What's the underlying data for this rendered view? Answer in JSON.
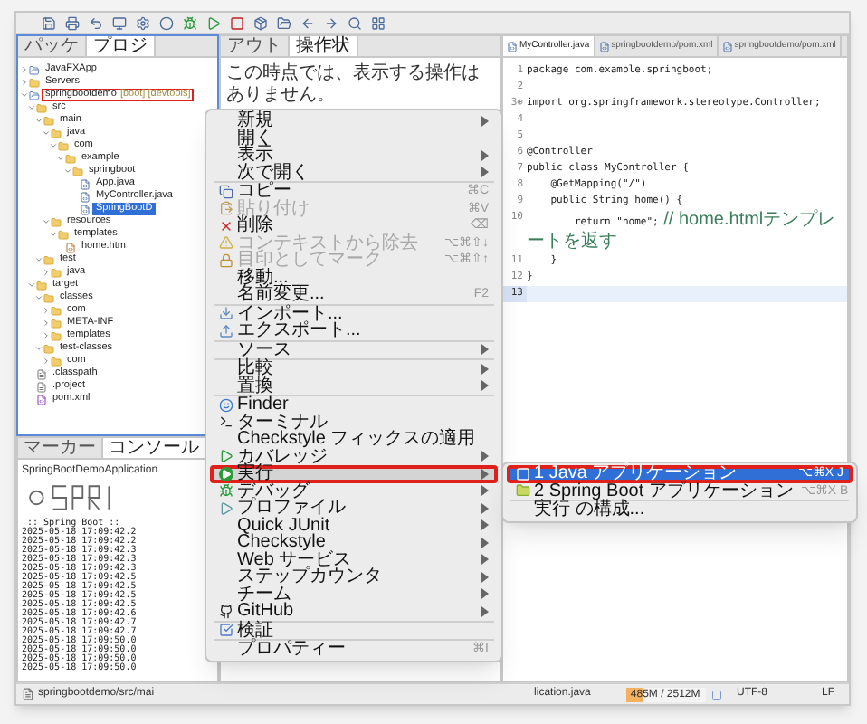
{
  "explorer": {
    "tabs": [
      {
        "label": "パッケ",
        "selected": false
      },
      {
        "label": "プロジ",
        "selected": true
      }
    ],
    "tree": [
      {
        "label": "JavaFXApp",
        "kind": "project",
        "expanded": false,
        "selected": false,
        "annotated": false
      },
      {
        "label": "Servers",
        "kind": "folder",
        "expanded": false,
        "selected": false,
        "annotated": false
      },
      {
        "label": "springbootdemo",
        "decoration": "[boot] [devtools]",
        "kind": "project",
        "expanded": true,
        "selected": false,
        "annotated": true,
        "children": [
          {
            "label": "src",
            "kind": "folder",
            "expanded": true,
            "selected": false,
            "annotated": false,
            "children": [
              {
                "label": "main",
                "kind": "folder",
                "expanded": true,
                "selected": false,
                "annotated": false,
                "children": [
                  {
                    "label": "java",
                    "kind": "folder",
                    "expanded": true,
                    "selected": false,
                    "annotated": false,
                    "children": [
                      {
                        "label": "com",
                        "kind": "folder",
                        "expanded": true,
                        "selected": false,
                        "annotated": false,
                        "children": [
                          {
                            "label": "example",
                            "kind": "folder",
                            "expanded": true,
                            "selected": false,
                            "annotated": false,
                            "children": [
                              {
                                "label": "springboot",
                                "kind": "folder",
                                "expanded": true,
                                "selected": false,
                                "annotated": false,
                                "children": [
                                  {
                                    "label": "App.java",
                                    "kind": "java",
                                    "selected": false,
                                    "annotated": false
                                  },
                                  {
                                    "label": "MyController.java",
                                    "kind": "java",
                                    "selected": false,
                                    "annotated": false
                                  },
                                  {
                                    "label": "SpringBootD",
                                    "kind": "java",
                                    "selected": true,
                                    "annotated": false
                                  }
                                ]
                              }
                            ]
                          }
                        ]
                      }
                    ]
                  },
                  {
                    "label": "resources",
                    "kind": "folder",
                    "expanded": true,
                    "selected": false,
                    "annotated": false,
                    "children": [
                      {
                        "label": "templates",
                        "kind": "folder",
                        "expanded": true,
                        "selected": false,
                        "annotated": false,
                        "children": [
                          {
                            "label": "home.htm",
                            "kind": "html",
                            "selected": false,
                            "annotated": false
                          }
                        ]
                      }
                    ]
                  }
                ]
              },
              {
                "label": "test",
                "kind": "folder",
                "expanded": true,
                "selected": false,
                "annotated": false,
                "children": [
                  {
                    "label": "java",
                    "kind": "folder",
                    "expanded": false,
                    "selected": false,
                    "annotated": false
                  }
                ]
              }
            ]
          },
          {
            "label": "target",
            "kind": "folder",
            "expanded": true,
            "selected": false,
            "annotated": false,
            "children": [
              {
                "label": "classes",
                "kind": "folder",
                "expanded": true,
                "selected": false,
                "annotated": false,
                "children": [
                  {
                    "label": "com",
                    "kind": "folder",
                    "expanded": false,
                    "selected": false,
                    "annotated": false
                  },
                  {
                    "label": "META-INF",
                    "kind": "folder",
                    "expanded": false,
                    "selected": false,
                    "annotated": false
                  },
                  {
                    "label": "templates",
                    "kind": "folder",
                    "expanded": false,
                    "selected": false,
                    "annotated": false
                  }
                ]
              },
              {
                "label": "test-classes",
                "kind": "folder",
                "expanded": true,
                "selected": false,
                "annotated": false,
                "children": [
                  {
                    "label": "com",
                    "kind": "folder",
                    "expanded": false,
                    "selected": false,
                    "annotated": false
                  }
                ]
              }
            ]
          },
          {
            "label": ".classpath",
            "kind": "file",
            "selected": false,
            "annotated": false
          },
          {
            "label": ".project",
            "kind": "file",
            "selected": false,
            "annotated": false
          },
          {
            "label": "pom.xml",
            "kind": "xml",
            "selected": false,
            "annotated": false
          }
        ]
      }
    ]
  },
  "operations": {
    "tabs": [
      {
        "label": "アウト",
        "selected": false
      },
      {
        "label": "操作状",
        "selected": true
      }
    ],
    "message": "この時点では、表示する操作はありません。"
  },
  "console": {
    "tabs": [
      {
        "label": "マーカー",
        "selected": false
      },
      {
        "label": "コンソール",
        "selected": true
      }
    ],
    "title": "SpringBootDemoApplication",
    "banner_caption": " :: Spring Boot ::",
    "lines": [
      "2025-05-18 17:09:42.2",
      "2025-05-18 17:09:42.2",
      "2025-05-18 17:09:42.3",
      "2025-05-18 17:09:42.3",
      "2025-05-18 17:09:42.3",
      "2025-05-18 17:09:42.5",
      "2025-05-18 17:09:42.5",
      "2025-05-18 17:09:42.5",
      "2025-05-18 17:09:42.5",
      "2025-05-18 17:09:42.6",
      "2025-05-18 17:09:42.7",
      "2025-05-18 17:09:42.7",
      "2025-05-18 17:09:50.0",
      "2025-05-18 17:09:50.0",
      "2025-05-18 17:09:50.0",
      "2025-05-18 17:09:50.0"
    ]
  },
  "editor": {
    "tabs": [
      {
        "label": "MyController.java",
        "selected": true
      },
      {
        "label": "springbootdemo/pom.xml",
        "selected": false
      },
      {
        "label": "springbootdemo/pom.xml",
        "selected": false
      }
    ],
    "lines": [
      {
        "number": "1",
        "text": "package com.example.springboot;",
        "current": false
      },
      {
        "number": "2",
        "current": false
      },
      {
        "number": "3⊕",
        "text": "import org.springframework.stereotype.Controller;",
        "current": false
      },
      {
        "number": "4",
        "current": false
      },
      {
        "number": "5",
        "current": false
      },
      {
        "number": "6",
        "text": "@Controller",
        "current": false
      },
      {
        "number": "7",
        "text": "public class MyController {",
        "current": false
      },
      {
        "number": "8",
        "text": "    @GetMapping(\"/\")",
        "current": false
      },
      {
        "number": "9",
        "text": "    public String home() {",
        "current": false
      },
      {
        "number": "10",
        "text": "        return \"home\";",
        "comment": " // home.htmlテンプレートを返す",
        "current": false
      },
      {
        "number": "11",
        "text": "    }",
        "current": false
      },
      {
        "number": "12",
        "text": "}",
        "current": false
      },
      {
        "number": "13",
        "current": true
      }
    ]
  },
  "context_menu": [
    {
      "kind": "item",
      "label": "新規",
      "submenu": true,
      "disabled": false,
      "selected": false,
      "annotated": false
    },
    {
      "kind": "item",
      "label": "開く",
      "submenu": false,
      "disabled": false,
      "selected": false,
      "annotated": false
    },
    {
      "kind": "item",
      "label": "表示",
      "submenu": true,
      "disabled": false,
      "selected": false,
      "annotated": false
    },
    {
      "kind": "item",
      "label": "次で開く",
      "submenu": true,
      "disabled": false,
      "selected": false,
      "annotated": false
    },
    {
      "kind": "separator"
    },
    {
      "kind": "copy",
      "label": "コピー",
      "shortcut": "⌘C",
      "submenu": false,
      "disabled": false,
      "selected": false,
      "annotated": false
    },
    {
      "kind": "paste",
      "label": "貼り付け",
      "shortcut": "⌘V",
      "submenu": false,
      "disabled": true,
      "selected": false,
      "annotated": false
    },
    {
      "kind": "delete",
      "label": "削除",
      "shortcut": "⌫",
      "submenu": false,
      "disabled": false,
      "selected": false,
      "annotated": false
    },
    {
      "kind": "warning",
      "label": "コンテキストから除去",
      "shortcut": "⌥⌘⇧↓",
      "submenu": false,
      "disabled": true,
      "selected": false,
      "annotated": false
    },
    {
      "kind": "lock",
      "label": "目印としてマーク",
      "shortcut": "⌥⌘⇧↑",
      "submenu": false,
      "disabled": true,
      "selected": false,
      "annotated": false
    },
    {
      "kind": "item",
      "label": "移動...",
      "submenu": false,
      "disabled": false,
      "selected": false,
      "annotated": false
    },
    {
      "kind": "item",
      "label": "名前変更...",
      "shortcut": "F2",
      "submenu": false,
      "disabled": false,
      "selected": false,
      "annotated": false
    },
    {
      "kind": "separator"
    },
    {
      "kind": "import",
      "label": "インポート...",
      "submenu": false,
      "disabled": false,
      "selected": false,
      "annotated": false
    },
    {
      "kind": "export",
      "label": "エクスポート...",
      "submenu": false,
      "disabled": false,
      "selected": false,
      "annotated": false
    },
    {
      "kind": "separator"
    },
    {
      "kind": "item",
      "label": "ソース",
      "submenu": true,
      "disabled": false,
      "selected": false,
      "annotated": false
    },
    {
      "kind": "separator"
    },
    {
      "kind": "item",
      "label": "比較",
      "submenu": true,
      "disabled": false,
      "selected": false,
      "annotated": false
    },
    {
      "kind": "item",
      "label": "置換",
      "submenu": true,
      "disabled": false,
      "selected": false,
      "annotated": false
    },
    {
      "kind": "separator"
    },
    {
      "kind": "finder",
      "label": "Finder",
      "submenu": false,
      "disabled": false,
      "selected": false,
      "annotated": false
    },
    {
      "kind": "terminal",
      "label": "ターミナル",
      "submenu": false,
      "disabled": false,
      "selected": false,
      "annotated": false
    },
    {
      "kind": "item",
      "label": "Checkstyle フィックスの適用",
      "submenu": false,
      "disabled": false,
      "selected": false,
      "annotated": false
    },
    {
      "kind": "coverage",
      "label": "カバレッジ",
      "submenu": true,
      "disabled": false,
      "selected": false,
      "annotated": false
    },
    {
      "kind": "run",
      "label": "実行",
      "submenu": true,
      "disabled": false,
      "selected": true,
      "annotated": true,
      "children": [
        {
          "kind": "app",
          "label": "1 Java アプリケーション",
          "shortcut": "⌥⌘X J",
          "selected": true,
          "annotated": true
        },
        {
          "kind": "folder",
          "label": "2 Spring Boot アプリケーション",
          "shortcut": "⌥⌘X B",
          "selected": false,
          "annotated": false
        },
        {
          "kind": "separator"
        },
        {
          "kind": "item",
          "label": "実行 の構成...",
          "selected": false,
          "annotated": false
        }
      ]
    },
    {
      "kind": "debug",
      "label": "デバッグ",
      "submenu": true,
      "disabled": false,
      "selected": false,
      "annotated": false
    },
    {
      "kind": "profile",
      "label": "プロファイル",
      "submenu": true,
      "disabled": false,
      "selected": false,
      "annotated": false
    },
    {
      "kind": "item",
      "label": "Quick JUnit",
      "submenu": true,
      "disabled": false,
      "selected": false,
      "annotated": false
    },
    {
      "kind": "item",
      "label": "Checkstyle",
      "submenu": true,
      "disabled": false,
      "selected": false,
      "annotated": false
    },
    {
      "kind": "item",
      "label": "Web サービス",
      "submenu": true,
      "disabled": false,
      "selected": false,
      "annotated": false
    },
    {
      "kind": "item",
      "label": "ステップカウンタ",
      "submenu": true,
      "disabled": false,
      "selected": false,
      "annotated": false
    },
    {
      "kind": "item",
      "label": "チーム",
      "submenu": true,
      "disabled": false,
      "selected": false,
      "annotated": false
    },
    {
      "kind": "github",
      "label": "GitHub",
      "submenu": true,
      "disabled": false,
      "selected": false,
      "annotated": false
    },
    {
      "kind": "separator"
    },
    {
      "kind": "check",
      "label": "検証",
      "submenu": false,
      "disabled": false,
      "selected": false,
      "annotated": false
    },
    {
      "kind": "separator"
    },
    {
      "kind": "item",
      "label": "プロパティー",
      "shortcut": "⌘I",
      "submenu": false,
      "disabled": false,
      "selected": false,
      "annotated": false
    }
  ],
  "status_bar": {
    "path_start": "springbootdemo/src/mai",
    "path_end": "lication.java",
    "memory": {
      "reading": "485M / 2512M",
      "level": 0.19
    },
    "encoding": "UTF-8",
    "line_delimiter": "LF"
  }
}
